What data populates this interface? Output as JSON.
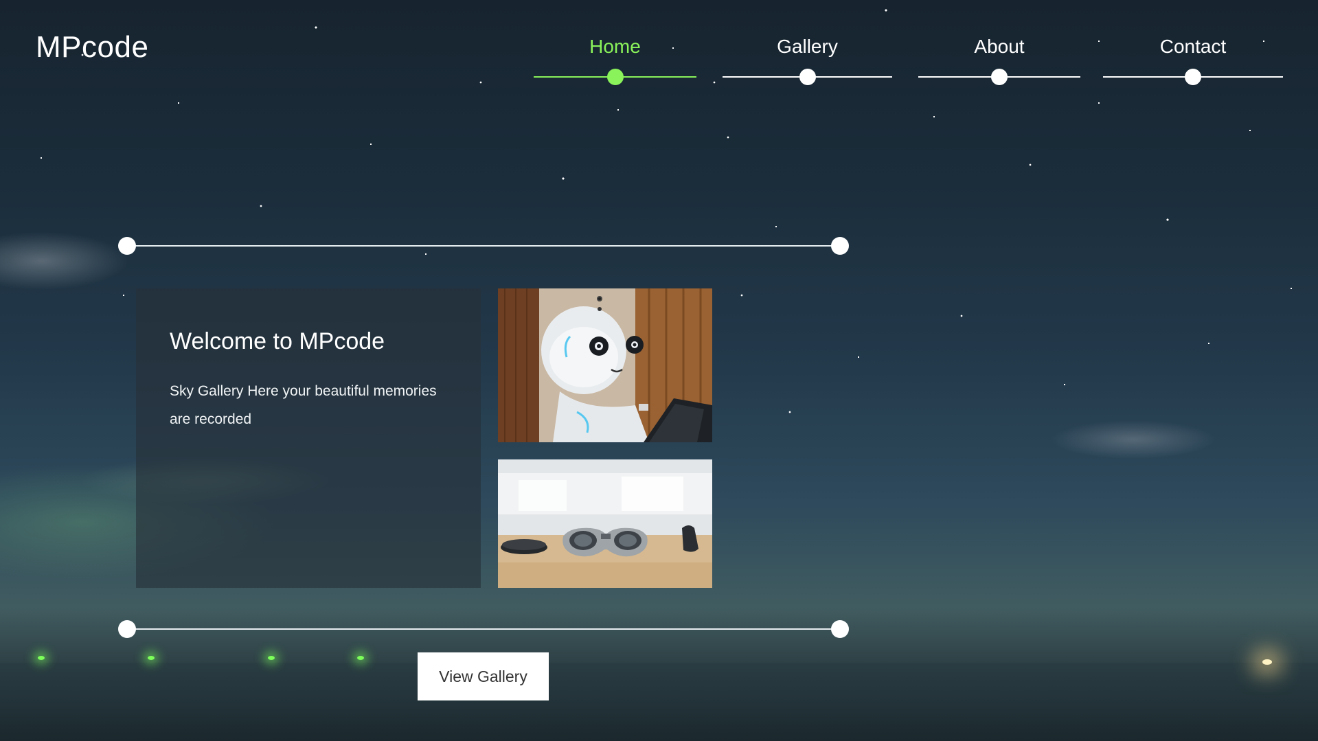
{
  "brand": {
    "logo_text": "MPcode"
  },
  "nav": {
    "items": [
      {
        "label": "Home",
        "active": true
      },
      {
        "label": "Gallery",
        "active": false
      },
      {
        "label": "About",
        "active": false
      },
      {
        "label": "Contact",
        "active": false
      }
    ]
  },
  "welcome": {
    "title": "Welcome to MPcode",
    "text": "Sky Gallery Here your beautiful memories are recorded"
  },
  "gallery": {
    "images": [
      {
        "icon": "robot-photo"
      },
      {
        "icon": "vr-headset-photo"
      }
    ]
  },
  "cta": {
    "label": "View Gallery"
  },
  "colors": {
    "accent": "#8af25a",
    "text": "#ffffff",
    "button_bg": "#ffffff",
    "button_text": "#333333"
  }
}
